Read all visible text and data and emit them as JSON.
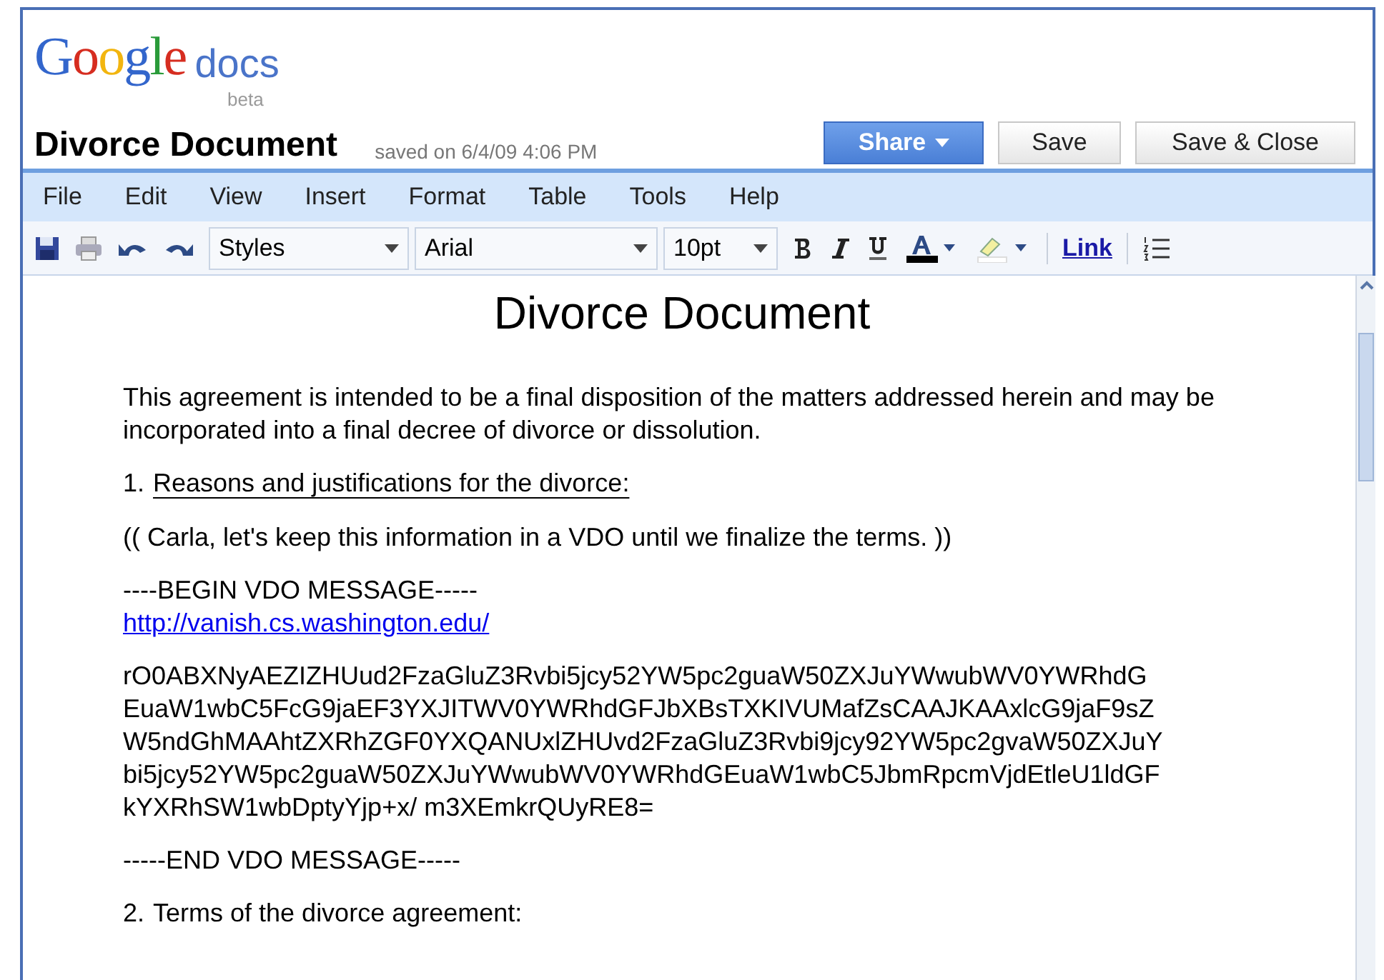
{
  "logo": {
    "brand": "Google",
    "product": "docs",
    "tag": "beta"
  },
  "document": {
    "title": "Divorce Document",
    "saved": "saved on 6/4/09 4:06 PM"
  },
  "buttons": [
    {
      "label": "Share",
      "kind": "primary",
      "dropdown": true
    },
    {
      "label": "Save",
      "kind": "plain",
      "dropdown": false
    },
    {
      "label": "Save & Close",
      "kind": "plain",
      "dropdown": false
    }
  ],
  "menu": [
    "File",
    "Edit",
    "View",
    "Insert",
    "Format",
    "Table",
    "Tools",
    "Help"
  ],
  "toolbar": {
    "style": "Styles",
    "font": "Arial",
    "size": "10pt",
    "link": "Link"
  },
  "body": [
    {
      "kind": "heading",
      "text": "Divorce Document"
    },
    {
      "kind": "paragraph",
      "text": "This agreement is intended to be a final disposition of the matters addressed herein and may be incorporated into a final decree of divorce or dissolution."
    },
    {
      "kind": "section",
      "number": "1.",
      "text": "Reasons and justifications for the divorce:",
      "underline": true
    },
    {
      "kind": "paragraph",
      "text": "(( Carla, let's keep this information in a VDO until we finalize the terms. ))"
    },
    {
      "kind": "marker",
      "text": "----BEGIN VDO MESSAGE-----",
      "link": "http://vanish.cs.washington.edu/"
    },
    {
      "kind": "code",
      "lines": [
        "rO0ABXNyAEZIZHUud2FzaGluZ3Rvbi5jcy52YW5pc2guaW50ZXJuYWwubWV0YWRhdG",
        "EuaW1wbC5FcG9jaEF3YXJITWV0YWRhdGFJbXBsTXKIVUMafZsCAAJKAAxlcG9jaF9sZ",
        "W5ndGhMAAhtZXRhZGF0YXQANUxlZHUvd2FzaGluZ3Rvbi9jcy92YW5pc2gvaW50ZXJuY",
        "bi5jcy52YW5pc2guaW50ZXJuYWwubWV0YWRhdGEuaW1wbC5JbmRpcmVjdEtleU1ldGF",
        "kYXRhSW1wbDptyYjp+x/ m3XEmkrQUyRE8="
      ]
    },
    {
      "kind": "marker",
      "text": "-----END VDO MESSAGE-----"
    },
    {
      "kind": "section",
      "number": "2.",
      "text": "Terms of the divorce agreement:",
      "underline": false
    }
  ]
}
